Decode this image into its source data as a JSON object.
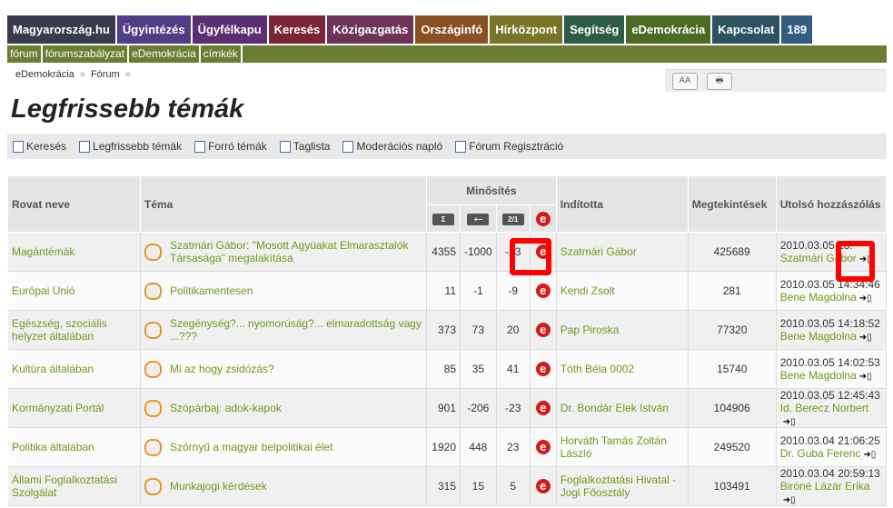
{
  "topnav": [
    {
      "label": "Magyarország.hu",
      "color": "#3a3a4e"
    },
    {
      "label": "Ügyintézés",
      "color": "#4f3e86"
    },
    {
      "label": "Ügyfélkapu",
      "color": "#5a2e70"
    },
    {
      "label": "Keresés",
      "color": "#7a2434"
    },
    {
      "label": "Közigazgatás",
      "color": "#6e3458"
    },
    {
      "label": "Országinfó",
      "color": "#8a5224"
    },
    {
      "label": "Hírközpont",
      "color": "#7a7428"
    },
    {
      "label": "Segítség",
      "color": "#2d5c45"
    },
    {
      "label": "eDemokrácia",
      "color": "#4d6a22"
    },
    {
      "label": "Kapcsolat",
      "color": "#2d5262"
    },
    {
      "label": "189",
      "color": "#335c80"
    }
  ],
  "subnav": [
    "fórum",
    "fórumszabályzat",
    "eDemokrácia",
    "címkék"
  ],
  "breadcrumb": {
    "item1": "eDemokrácia",
    "sep": "»",
    "item2": "Fórum",
    "sep2": "»"
  },
  "tools": {
    "font_size": "AA",
    "print": "🖶"
  },
  "title": "Legfrissebb témák",
  "actions": [
    "Keresés",
    "Legfrissebb témák",
    "Forró témák",
    "Taglista",
    "Moderációs napló",
    "Fórum Regisztráció"
  ],
  "columns": {
    "rovat": "Rovat neve",
    "tema": "Téma",
    "minosites": "Minősítés",
    "inditotta": "Indította",
    "megtekintesek": "Megtekintések",
    "utolso": "Utolsó hozzászólás",
    "sub1": "Σ",
    "sub2": "+−",
    "sub3": "2/1",
    "sub4": "e"
  },
  "rows": [
    {
      "rovat": "Magántémák",
      "tema": "Szatmári Gábor: \"Mosott Agyúakat Elmarasztalók Társasága\" megalakítása",
      "m1": "4355",
      "m2": "-1000",
      "m3": "-23",
      "inditotta": "Szatmári Gábor",
      "views": "425689",
      "last_date": "2010.03.05 18:",
      "last_user": "Szatmári Gábor"
    },
    {
      "rovat": "Európai Unió",
      "tema": "Politikamentesen",
      "m1": "11",
      "m2": "-1",
      "m3": "-9",
      "inditotta": "Kendi Zsolt",
      "views": "281",
      "last_date": "2010.03.05 14:34:46",
      "last_user": "Bene Magdolna"
    },
    {
      "rovat": "Egészség, szociális helyzet általában",
      "tema": "Szegénység?... nyomorúság?... elmaradottság vagy ...???",
      "m1": "373",
      "m2": "73",
      "m3": "20",
      "inditotta": "Pap Piroska",
      "views": "77320",
      "last_date": "2010.03.05 14:18:52",
      "last_user": "Bene Magdolna"
    },
    {
      "rovat": "Kultúra általában",
      "tema": "Mi az hogy zsidózás?",
      "m1": "85",
      "m2": "35",
      "m3": "41",
      "inditotta": "Tóth Béla 0002",
      "views": "15740",
      "last_date": "2010.03.05 14:02:53",
      "last_user": "Bene Magdolna"
    },
    {
      "rovat": "Kormányzati Portál",
      "tema": "Szópárbaj: adok-kapok",
      "m1": "901",
      "m2": "-206",
      "m3": "-23",
      "inditotta": "Dr. Bondár Elek István",
      "views": "104906",
      "last_date": "2010.03.05 12:45:43",
      "last_user": "Id. Berecz Norbert"
    },
    {
      "rovat": "Politika általában",
      "tema": "Szörnyű a magyar belpolitikai élet",
      "m1": "1920",
      "m2": "448",
      "m3": "23",
      "inditotta": "Horváth Tamás Zoltán László",
      "views": "249520",
      "last_date": "2010.03.04 21:06:25",
      "last_user": "Dr. Guba Ferenc"
    },
    {
      "rovat": "Állami Foglalkoztatási Szolgálat",
      "tema": "Munkajogi kérdések",
      "m1": "315",
      "m2": "15",
      "m3": "5",
      "inditotta": "Foglalkoztatási Hivatal - Jogi Főosztály",
      "views": "103491",
      "last_date": "2010.03.04 20:59:13",
      "last_user": "Biróné Lázár Erika"
    }
  ]
}
